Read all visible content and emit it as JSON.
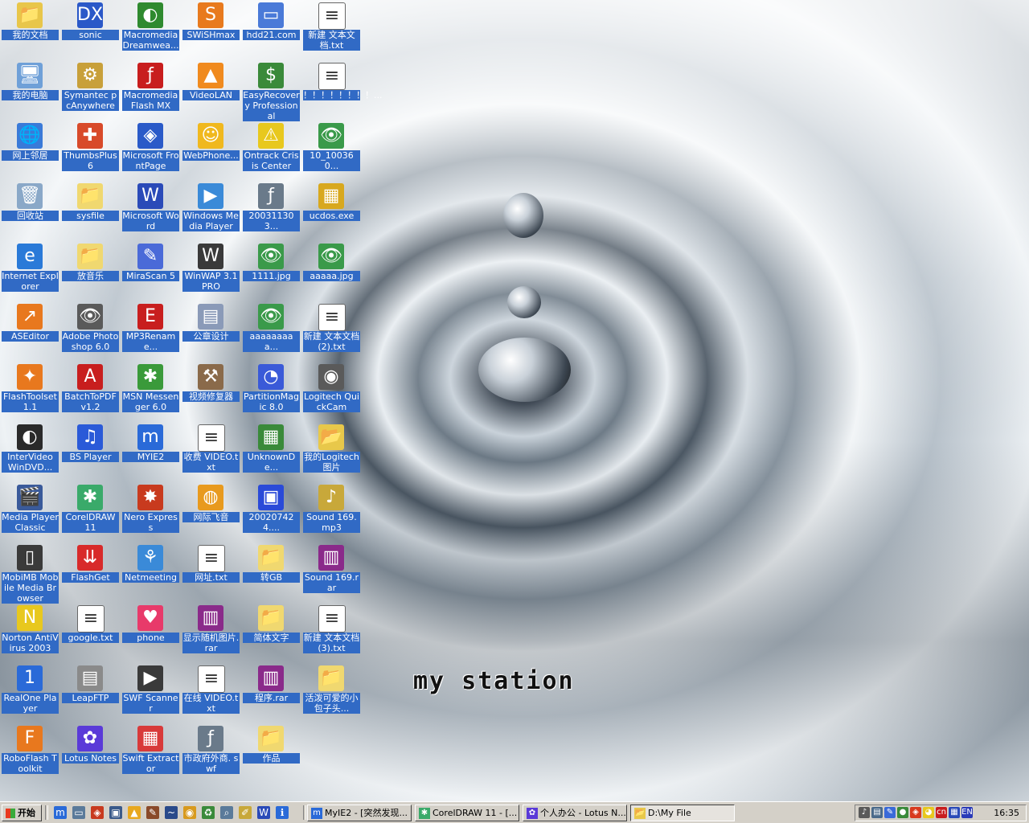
{
  "wallpaper": {
    "wordmark": "my station"
  },
  "icons": [
    {
      "label": "我的文档",
      "glyph": "📁",
      "color": "#e8c64a"
    },
    {
      "label": "sonic",
      "glyph": "DX",
      "color": "#2a58c8"
    },
    {
      "label": "Macromedia Dreamwea...",
      "glyph": "◐",
      "color": "#2f8a2f"
    },
    {
      "label": "SWiSHmax",
      "glyph": "S",
      "color": "#e87a1e"
    },
    {
      "label": "hdd21.com",
      "glyph": "▭",
      "color": "#4a7ad8"
    },
    {
      "label": "新建 文本文档.txt",
      "glyph": "≡",
      "color": "#ffffff"
    },
    {
      "label": "我的电脑",
      "glyph": "🖥",
      "color": "#6fa0d8"
    },
    {
      "label": "Symantec pcAnywhere",
      "glyph": "⚙",
      "color": "#c8a03a"
    },
    {
      "label": "Macromedia Flash MX",
      "glyph": "ƒ",
      "color": "#c81e1e"
    },
    {
      "label": "VideoLAN",
      "glyph": "▲",
      "color": "#f08a1e"
    },
    {
      "label": "EasyRecovery Professional",
      "glyph": "$",
      "color": "#3a8a3a"
    },
    {
      "label": "！！！！！！！！...",
      "glyph": "≡",
      "color": "#ffffff"
    },
    {
      "label": "网上邻居",
      "glyph": "🌐",
      "color": "#3a7ad8"
    },
    {
      "label": "ThumbsPlus 6",
      "glyph": "✚",
      "color": "#d84a2a"
    },
    {
      "label": "Microsoft FrontPage",
      "glyph": "◈",
      "color": "#2a5ac8"
    },
    {
      "label": "WebPhone...",
      "glyph": "☺",
      "color": "#f0b81e"
    },
    {
      "label": "Ontrack Crisis Center",
      "glyph": "⚠",
      "color": "#e8c81e"
    },
    {
      "label": "10_100360...",
      "glyph": "👁",
      "color": "#3a9a4a"
    },
    {
      "label": "回收站",
      "glyph": "🗑",
      "color": "#8aa8c8"
    },
    {
      "label": "sysfile",
      "glyph": "📁",
      "color": "#f0d870"
    },
    {
      "label": "Microsoft Word",
      "glyph": "W",
      "color": "#2a4ab8"
    },
    {
      "label": "Windows Media Player",
      "glyph": "▶",
      "color": "#3a8ad8"
    },
    {
      "label": "200311303...",
      "glyph": "ƒ",
      "color": "#6a7a8a"
    },
    {
      "label": "ucdos.exe",
      "glyph": "▦",
      "color": "#d8a81e"
    },
    {
      "label": "Internet Explorer",
      "glyph": "e",
      "color": "#2a7ad8"
    },
    {
      "label": "放音乐",
      "glyph": "📁",
      "color": "#f0d870"
    },
    {
      "label": "MiraScan 5",
      "glyph": "✎",
      "color": "#4a6ad8"
    },
    {
      "label": "WinWAP 3.1 PRO",
      "glyph": "W",
      "color": "#3a3a3a"
    },
    {
      "label": "1111.jpg",
      "glyph": "👁",
      "color": "#3a9a4a"
    },
    {
      "label": "aaaaa.jpg",
      "glyph": "👁",
      "color": "#3a9a4a"
    },
    {
      "label": "ASEditor",
      "glyph": "↗",
      "color": "#e8781e"
    },
    {
      "label": "Adobe Photoshop 6.0",
      "glyph": "👁",
      "color": "#5a5a5a"
    },
    {
      "label": "MP3Rename...",
      "glyph": "E",
      "color": "#c81e1e"
    },
    {
      "label": "公章设计",
      "glyph": "▤",
      "color": "#8a9ab8"
    },
    {
      "label": "aaaaaaaaa...",
      "glyph": "👁",
      "color": "#3a9a4a"
    },
    {
      "label": "新建 文本文档 (2).txt",
      "glyph": "≡",
      "color": "#ffffff"
    },
    {
      "label": "FlashToolset 1.1",
      "glyph": "✦",
      "color": "#e8781e"
    },
    {
      "label": "BatchToPDF v1.2",
      "glyph": "A",
      "color": "#c81e1e"
    },
    {
      "label": "MSN Messenger 6.0",
      "glyph": "✱",
      "color": "#3a9a3a"
    },
    {
      "label": "视频修复器",
      "glyph": "⚒",
      "color": "#8a6a4a"
    },
    {
      "label": "PartitionMagic 8.0",
      "glyph": "◔",
      "color": "#3a5ad8"
    },
    {
      "label": "Logitech QuickCam",
      "glyph": "◉",
      "color": "#5a5a5a"
    },
    {
      "label": "InterVideo WinDVD...",
      "glyph": "◐",
      "color": "#2a2a2a"
    },
    {
      "label": "BS Player",
      "glyph": "♫",
      "color": "#2a5ad8"
    },
    {
      "label": "MYIE2",
      "glyph": "m",
      "color": "#2a6ad8"
    },
    {
      "label": "收费 VIDEO.txt",
      "glyph": "≡",
      "color": "#ffffff"
    },
    {
      "label": "UnknownDe...",
      "glyph": "▦",
      "color": "#3a8a3a"
    },
    {
      "label": "我的Logitech 图片",
      "glyph": "📂",
      "color": "#e8c84a"
    },
    {
      "label": "Media Player Classic",
      "glyph": "🎬",
      "color": "#3a5a9a"
    },
    {
      "label": "CorelDRAW 11",
      "glyph": "✱",
      "color": "#3aaa6a"
    },
    {
      "label": "Nero Express",
      "glyph": "✸",
      "color": "#c83a1e"
    },
    {
      "label": "网际飞音",
      "glyph": "◍",
      "color": "#e89a1e"
    },
    {
      "label": "200207424....",
      "glyph": "▣",
      "color": "#2a4ad8"
    },
    {
      "label": "Sound 169.mp3",
      "glyph": "♪",
      "color": "#c8a83a"
    },
    {
      "label": "MobiMB Mobile Media Browser",
      "glyph": "▯",
      "color": "#3a3a3a"
    },
    {
      "label": "FlashGet",
      "glyph": "⇊",
      "color": "#d82a2a"
    },
    {
      "label": "Netmeeting",
      "glyph": "⚘",
      "color": "#3a8ad8"
    },
    {
      "label": "网址.txt",
      "glyph": "≡",
      "color": "#ffffff"
    },
    {
      "label": "转GB",
      "glyph": "📁",
      "color": "#f0d870"
    },
    {
      "label": "Sound 169.rar",
      "glyph": "▥",
      "color": "#8a2a8a"
    },
    {
      "label": "Norton AntiVirus 2003",
      "glyph": "N",
      "color": "#e8c81e"
    },
    {
      "label": "google.txt",
      "glyph": "≡",
      "color": "#ffffff"
    },
    {
      "label": "phone",
      "glyph": "♥",
      "color": "#e83a6a"
    },
    {
      "label": "显示随机图片.rar",
      "glyph": "▥",
      "color": "#8a2a8a"
    },
    {
      "label": "简体文字",
      "glyph": "📁",
      "color": "#f0d870"
    },
    {
      "label": "新建 文本文档 (3).txt",
      "glyph": "≡",
      "color": "#ffffff"
    },
    {
      "label": "RealOne Player",
      "glyph": "1",
      "color": "#2a6ad8"
    },
    {
      "label": "LeapFTP",
      "glyph": "▤",
      "color": "#8a8a8a"
    },
    {
      "label": "SWF Scanner",
      "glyph": "▶",
      "color": "#3a3a3a"
    },
    {
      "label": "在线 VIDEO.txt",
      "glyph": "≡",
      "color": "#ffffff"
    },
    {
      "label": "程序.rar",
      "glyph": "▥",
      "color": "#8a2a8a"
    },
    {
      "label": "活泼可爱的小包子头...",
      "glyph": "📁",
      "color": "#f0d870"
    },
    {
      "label": "RoboFlash Toolkit",
      "glyph": "F",
      "color": "#e8781e"
    },
    {
      "label": "Lotus Notes",
      "glyph": "✿",
      "color": "#5a3ad8"
    },
    {
      "label": "Swift Extractor",
      "glyph": "▦",
      "color": "#d83a3a"
    },
    {
      "label": "市政府外商. swf",
      "glyph": "ƒ",
      "color": "#6a7a8a"
    },
    {
      "label": "作品",
      "glyph": "📁",
      "color": "#f0d870"
    }
  ],
  "taskbar": {
    "start_label": "开始",
    "quick_launch": [
      {
        "icon": "myie2-icon",
        "glyph": "m",
        "color": "#2a6ad8"
      },
      {
        "icon": "desktop-icon",
        "glyph": "▭",
        "color": "#5a7a9a"
      },
      {
        "icon": "frontpage-icon",
        "glyph": "◈",
        "color": "#c83a1e"
      },
      {
        "icon": "terminal-icon",
        "glyph": "▣",
        "color": "#3a5a8a"
      },
      {
        "icon": "warning-icon",
        "glyph": "▲",
        "color": "#e8a81e"
      },
      {
        "icon": "tool-icon",
        "glyph": "✎",
        "color": "#8a4a2a"
      },
      {
        "icon": "stream-icon",
        "glyph": "~",
        "color": "#2a4a8a"
      },
      {
        "icon": "disc-icon",
        "glyph": "◉",
        "color": "#d89a1e"
      },
      {
        "icon": "recycle-icon",
        "glyph": "♻",
        "color": "#3a8a3a"
      },
      {
        "icon": "search-icon",
        "glyph": "⌕",
        "color": "#5a7a9a"
      },
      {
        "icon": "pen-icon",
        "glyph": "✐",
        "color": "#c8a83a"
      },
      {
        "icon": "word-icon",
        "glyph": "W",
        "color": "#2a4ab8"
      },
      {
        "icon": "info-icon",
        "glyph": "ℹ",
        "color": "#2a6ad8"
      }
    ],
    "tasks": [
      {
        "label": "MyIE2 - [突然发现...",
        "glyph": "m",
        "color": "#2a6ad8",
        "active": false
      },
      {
        "label": "CorelDRAW 11 - [...",
        "glyph": "✱",
        "color": "#3aaa6a",
        "active": false
      },
      {
        "label": "个人办公 - Lotus N...",
        "glyph": "✿",
        "color": "#5a3ad8",
        "active": false
      },
      {
        "label": "D:\\My File",
        "glyph": "📂",
        "color": "#e8c84a",
        "active": true
      }
    ],
    "tray": [
      {
        "icon": "volume-icon",
        "glyph": "♪",
        "color": "#5a5a5a"
      },
      {
        "icon": "network-icon",
        "glyph": "▤",
        "color": "#4a6a8a"
      },
      {
        "icon": "pen-tray-icon",
        "glyph": "✎",
        "color": "#3a6ad8"
      },
      {
        "icon": "globe-icon",
        "glyph": "●",
        "color": "#3a8a3a"
      },
      {
        "icon": "shield-icon",
        "glyph": "◈",
        "color": "#d83a1e"
      },
      {
        "icon": "qq-icon",
        "glyph": "◕",
        "color": "#e8c81e"
      },
      {
        "icon": "cn-input-icon",
        "glyph": "cn",
        "color": "#c81e1e"
      },
      {
        "icon": "ime-icon",
        "glyph": "▦",
        "color": "#2a4ab8"
      },
      {
        "icon": "en-icon",
        "glyph": "EN",
        "color": "#2a3ab8"
      }
    ],
    "clock": "16:35"
  }
}
